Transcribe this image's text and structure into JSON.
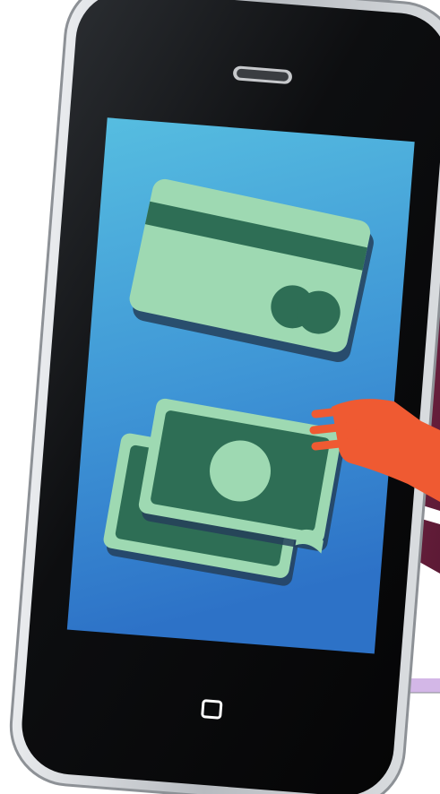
{
  "illustration": {
    "subject": "smartphone-with-payment-card-and-banknotes",
    "colors": {
      "phone_frame": "#c9ccd0",
      "phone_body": "#0b0b0b",
      "screen_top": "#52b9dd",
      "screen_bottom": "#2f79cb",
      "money_light": "#9ed9b2",
      "money_dark": "#2e6e55",
      "shadow": "#24405a",
      "hand_orange": "#ef5a32",
      "maroon": "#6e1f3f",
      "lavender": "#d3b7e7"
    },
    "icons": [
      "credit-card-icon",
      "banknotes-icon",
      "hand-icon",
      "speaker-grille-icon",
      "home-button-icon"
    ]
  }
}
